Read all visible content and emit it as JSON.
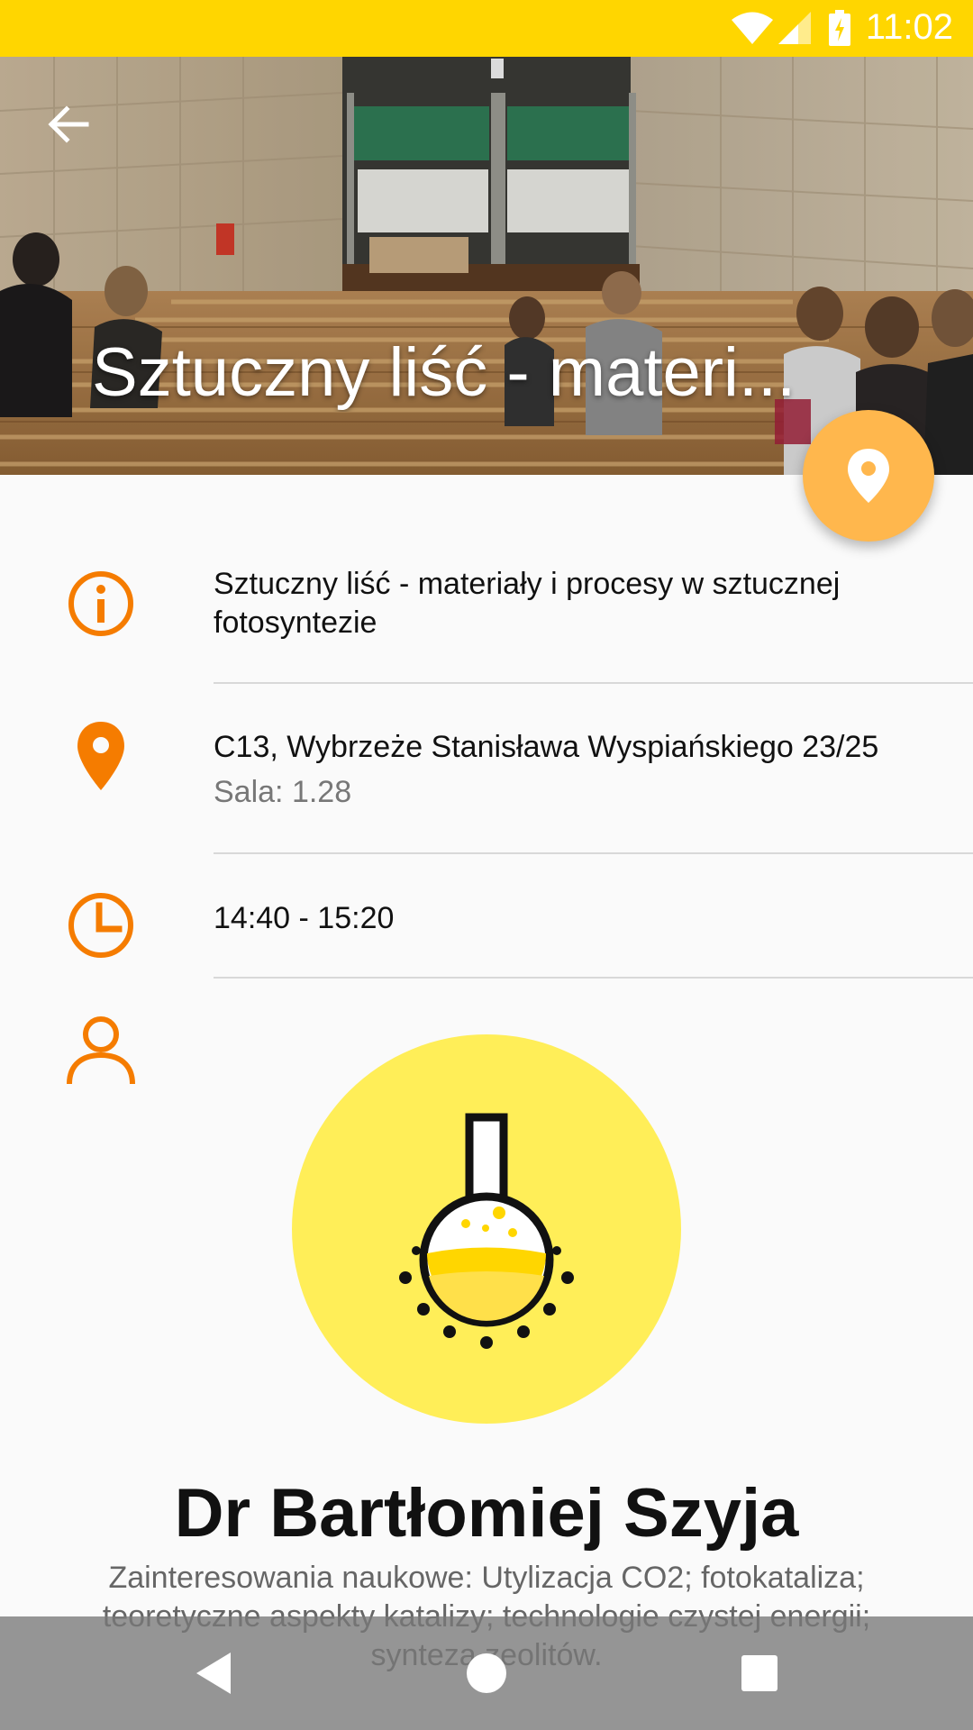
{
  "status_bar": {
    "time": "11:02"
  },
  "header": {
    "title": "Sztuczny liść - materi..."
  },
  "details": {
    "description": "Sztuczny liść - materiały i procesy w sztucznej fotosyntezie",
    "address": "C13, Wybrzeże Stanisława Wyspiańskiego 23/25",
    "room": "Sala: 1.28",
    "time": "14:40 - 15:20"
  },
  "speaker": {
    "name": "Dr Bartłomiej Szyja",
    "interests": "Zainteresowania naukowe: Utylizacja CO2; fotokataliza; teoretyczne aspekty katalizy; technologie czystej energii; synteza zeolitów."
  },
  "icons": {
    "back": "arrow-left-icon",
    "fab": "map-pin-icon",
    "info": "info-icon",
    "location": "location-pin-icon",
    "clock": "clock-icon",
    "person": "person-icon",
    "avatar": "flask-icon"
  },
  "colors": {
    "status_bar": "#ffd600",
    "accent": "#f57c00",
    "fab": "#ffb74d",
    "avatar_bg": "#ffee58"
  }
}
